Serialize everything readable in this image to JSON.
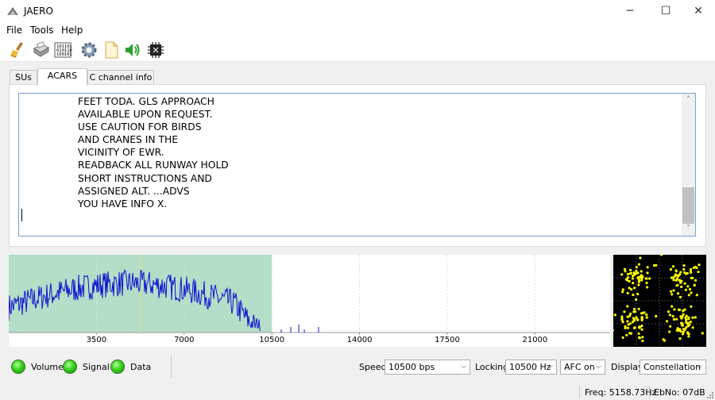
{
  "window": {
    "title": "JAERO",
    "minimize_glyph": "─",
    "maximize_glyph": "☐",
    "close_glyph": "✕"
  },
  "menu": {
    "items": [
      "File",
      "Tools",
      "Help"
    ]
  },
  "toolbar": {
    "icons": [
      "broom-icon",
      "printer-icon",
      "binary-data-icon",
      "gear-icon",
      "document-icon",
      "speaker-icon",
      "chip-icon"
    ]
  },
  "tabs": {
    "items": [
      "SUs",
      "ACARS",
      "C channel info"
    ],
    "active": "ACARS"
  },
  "acars": {
    "message_lines": [
      "FEET TODA. GLS APPROACH",
      "AVAILABLE UPON REQUEST.",
      "USE CAUTION FOR BIRDS",
      "AND CRANES IN THE",
      "VICINITY OF EWR.",
      "READBACK ALL RUNWAY HOLD",
      "SHORT INSTRUCTIONS AND",
      "ASSIGNED ALT. ...ADVS",
      "YOU HAVE INFO X."
    ],
    "scroll_up_glyph": "˄",
    "scroll_down_glyph": "˅"
  },
  "chart_data": {
    "type": "area",
    "x_ticks": [
      "3500",
      "7000",
      "10500",
      "14000",
      "17500",
      "21000"
    ],
    "x_tick_values": [
      3500,
      7000,
      10500,
      14000,
      17500,
      21000
    ],
    "xlim": [
      0,
      24000
    ],
    "passband": [
      0,
      10500
    ],
    "marker_x": 5250,
    "grid": true,
    "colors": {
      "passband": "#b3dec8",
      "signal": "#1010d0",
      "marker": "#e8e070",
      "grid": "#e0e0e0"
    }
  },
  "constellation": {
    "background": "#000000",
    "point_color": "#ffff00",
    "grid_color": "#404040"
  },
  "indicators": [
    {
      "label": "Volume",
      "state": "on"
    },
    {
      "label": "Signal",
      "state": "on"
    },
    {
      "label": "Data",
      "state": "on"
    }
  ],
  "controls": {
    "speed_label": "Speed",
    "speed_value": "10500 bps",
    "locking_label": "Locking",
    "locking_value": "10500 Hz",
    "afc_value": "AFC on",
    "display_label": "Display",
    "display_value": "Constellation"
  },
  "statusbar": {
    "freq": "Freq: 5158.73Hz",
    "ebno": "EbNo: 07dB"
  }
}
